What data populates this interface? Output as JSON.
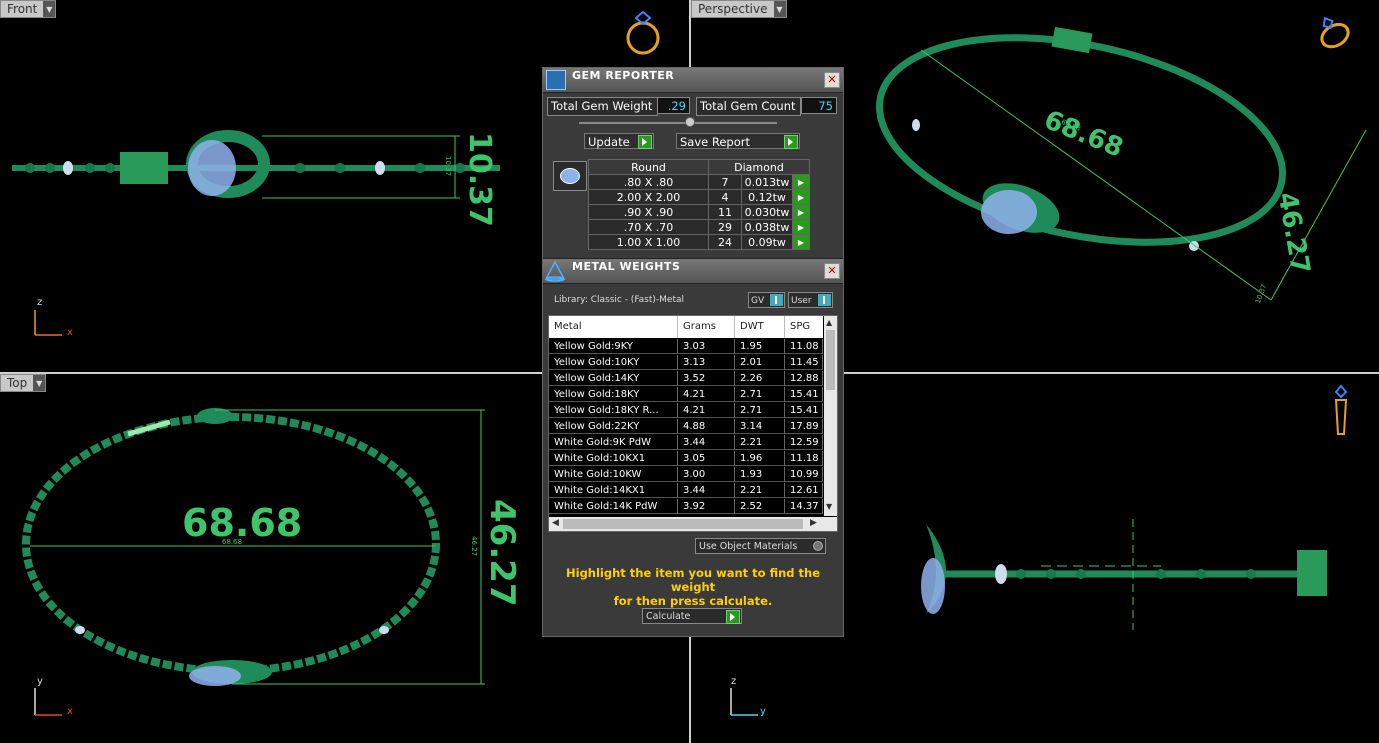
{
  "viewports": {
    "front": {
      "label": "Front",
      "dim_big": "10.37",
      "dim_small": "10.37",
      "axis_v": "z",
      "axis_h": "x"
    },
    "perspective": {
      "label": "Perspective",
      "dim_len": "68.68",
      "dim_len_small": "68.68",
      "dim_h": "46.27",
      "dim_h_small": "10.37"
    },
    "top": {
      "label": "Top",
      "dim_len": "68.68",
      "dim_len_small": "68.68",
      "dim_h": "46.27",
      "dim_h_small": "46.27",
      "axis_v": "y",
      "axis_h": "x"
    },
    "right": {
      "axis_v": "z",
      "axis_h": "y"
    }
  },
  "gem_reporter": {
    "title": "GEM REPORTER",
    "total_weight_label": "Total Gem Weight",
    "total_weight_value": ".29",
    "total_count_label": "Total Gem Count",
    "total_count_value": "75",
    "update_label": "Update",
    "save_label": "Save Report",
    "table_header": {
      "shape": "Round",
      "material": "Diamond"
    },
    "rows": [
      {
        "size": ".80 X .80",
        "count": "7",
        "weight": "0.013tw"
      },
      {
        "size": "2.00 X 2.00",
        "count": "4",
        "weight": "0.12tw"
      },
      {
        "size": ".90 X .90",
        "count": "11",
        "weight": "0.030tw"
      },
      {
        "size": ".70 X .70",
        "count": "29",
        "weight": "0.038tw"
      },
      {
        "size": "1.00 X 1.00",
        "count": "24",
        "weight": "0.09tw"
      }
    ]
  },
  "metal_weights": {
    "title": "METAL WEIGHTS",
    "library": "Library: Classic - (Fast)-Metal",
    "toggle_gv": "GV",
    "toggle_user": "User",
    "columns": [
      "Metal",
      "Grams",
      "DWT",
      "SPG"
    ],
    "rows": [
      {
        "metal": "Yellow Gold:9KY",
        "grams": "3.03",
        "dwt": "1.95",
        "spg": "11.08"
      },
      {
        "metal": "Yellow Gold:10KY",
        "grams": "3.13",
        "dwt": "2.01",
        "spg": "11.45"
      },
      {
        "metal": "Yellow Gold:14KY",
        "grams": "3.52",
        "dwt": "2.26",
        "spg": "12.88"
      },
      {
        "metal": "Yellow Gold:18KY",
        "grams": "4.21",
        "dwt": "2.71",
        "spg": "15.41"
      },
      {
        "metal": "Yellow Gold:18KY R...",
        "grams": "4.21",
        "dwt": "2.71",
        "spg": "15.41"
      },
      {
        "metal": "Yellow Gold:22KY",
        "grams": "4.88",
        "dwt": "3.14",
        "spg": "17.89"
      },
      {
        "metal": "White Gold:9K PdW",
        "grams": "3.44",
        "dwt": "2.21",
        "spg": "12.59"
      },
      {
        "metal": "White Gold:10KX1",
        "grams": "3.05",
        "dwt": "1.96",
        "spg": "11.18"
      },
      {
        "metal": "White Gold:10KW",
        "grams": "3.00",
        "dwt": "1.93",
        "spg": "10.99"
      },
      {
        "metal": "White Gold:14KX1",
        "grams": "3.44",
        "dwt": "2.21",
        "spg": "12.61"
      },
      {
        "metal": "White Gold:14K PdW",
        "grams": "3.92",
        "dwt": "2.52",
        "spg": "14.37"
      }
    ],
    "use_object_materials": "Use Object Materials",
    "hint_line1": "Highlight the item you want to find the weight",
    "hint_line2": "for then press calculate.",
    "calculate_label": "Calculate"
  },
  "colors": {
    "model": "#1f8a5a",
    "dimension": "#3ec46a",
    "gem": "#a8c8ff",
    "ring_icon": "#e8a020"
  }
}
